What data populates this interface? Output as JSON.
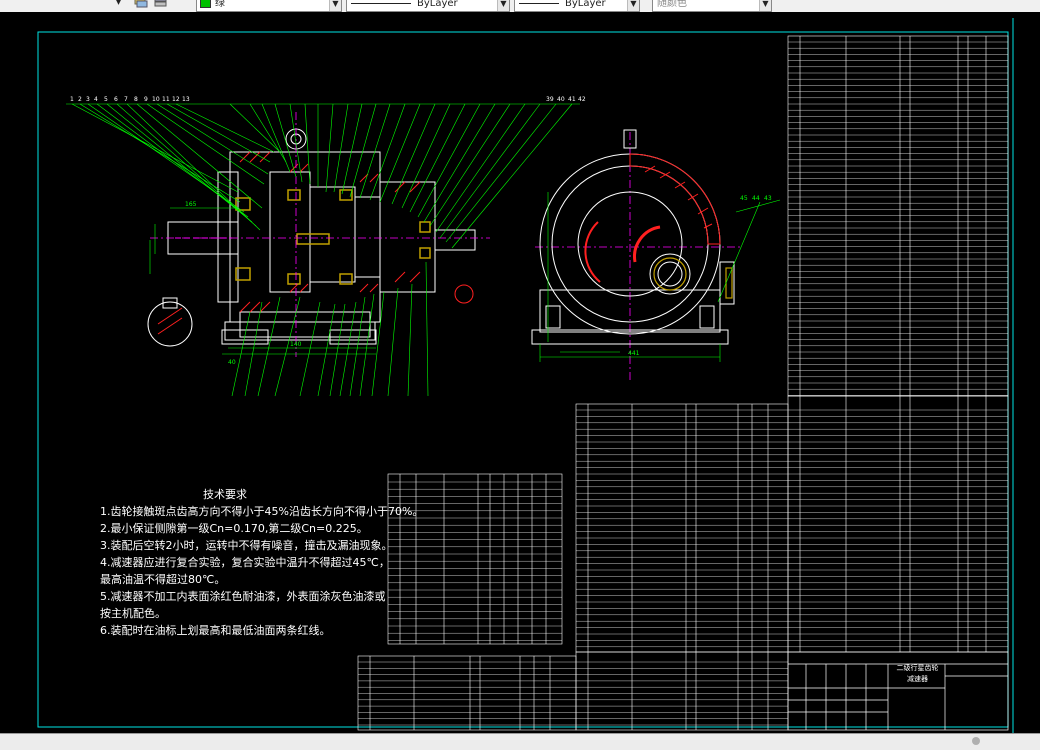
{
  "toolbar": {
    "color_name": "绿",
    "linetype": "ByLayer",
    "lineweight": "ByLayer",
    "plotstyle": "随颜色"
  },
  "colors": {
    "border": "#00e5e5",
    "geometry": "#ffffff",
    "dims": "#00ff00",
    "leaders": "#ffff00",
    "hatch": "#ff2020",
    "center": "#ff00ff",
    "highlight": "#c0a000"
  },
  "drawing": {
    "notes_title": "技术要求",
    "notes": [
      "1.齿轮接触斑点齿高方向不得小于45%沿齿长方向不得小于70%。",
      "2.最小保证侧隙第一级Cn=0.170,第二级Cn=0.225。",
      "3.装配后空转2小时，运转中不得有噪音，撞击及漏油现象。",
      "4.减速器应进行复合实验，复合实验中温升不得超过45℃，",
      "   最高油温不得超过80℃。",
      "5.减速器不加工内表面涂红色耐油漆，外表面涂灰色油漆或",
      "   按主机配色。",
      "6.装配时在油标上划最高和最低油面两条红线。"
    ],
    "title_block": {
      "name_line1": "二级行星齿轮",
      "name_line2": "减速器"
    },
    "dim_labels": [
      "165",
      "400",
      "441",
      "45",
      "44",
      "43",
      "25",
      "27"
    ],
    "balloon_numbers_left": [
      "1",
      "2",
      "3",
      "4",
      "5",
      "6",
      "7",
      "8",
      "9",
      "10",
      "11",
      "12",
      "13"
    ],
    "balloon_numbers_right": [
      "39",
      "40",
      "41",
      "42"
    ]
  }
}
